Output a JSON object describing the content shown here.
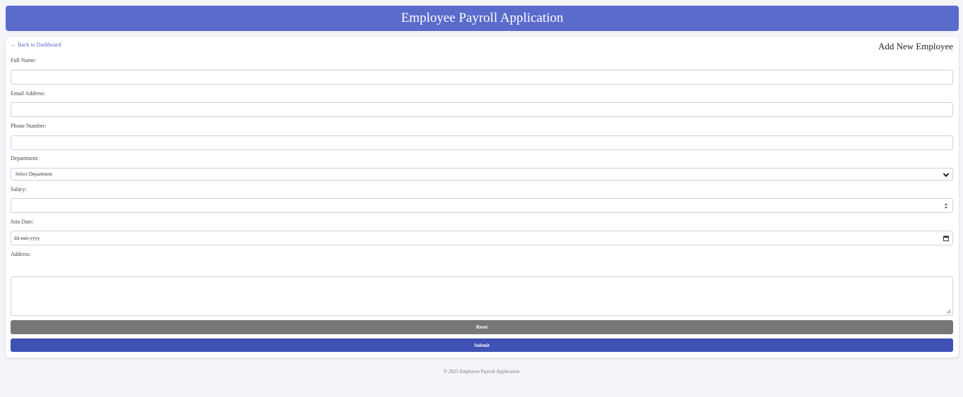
{
  "app": {
    "title": "Employee Payroll Application"
  },
  "nav": {
    "back_label": "← Back to Dashboard"
  },
  "page": {
    "heading": "Add New Employee"
  },
  "form": {
    "full_name": {
      "label": "Full Name:",
      "value": ""
    },
    "email": {
      "label": "Email Address:",
      "value": ""
    },
    "phone": {
      "label": "Phone Number:",
      "value": ""
    },
    "department": {
      "label": "Department:",
      "selected": "Select Department"
    },
    "salary": {
      "label": "Salary:",
      "value": ""
    },
    "join_date": {
      "label": "Join Date:",
      "placeholder": "dd-mm-yyyy"
    },
    "address": {
      "label": "Address:",
      "value": ""
    },
    "reset_label": "Reset",
    "submit_label": "Submit"
  },
  "footer": {
    "text": "© 2025 Employee Payroll Application"
  },
  "colors": {
    "header": "#5a6bcb",
    "link": "#5a6bcb",
    "reset_button": "#777777",
    "submit_button": "#3f51b5",
    "page_background": "#f4f5f9"
  },
  "icons": {
    "department": "chevron-down-icon",
    "salary": "spinner-icon",
    "join_date": "calendar-icon",
    "address": "resize-handle-icon"
  }
}
